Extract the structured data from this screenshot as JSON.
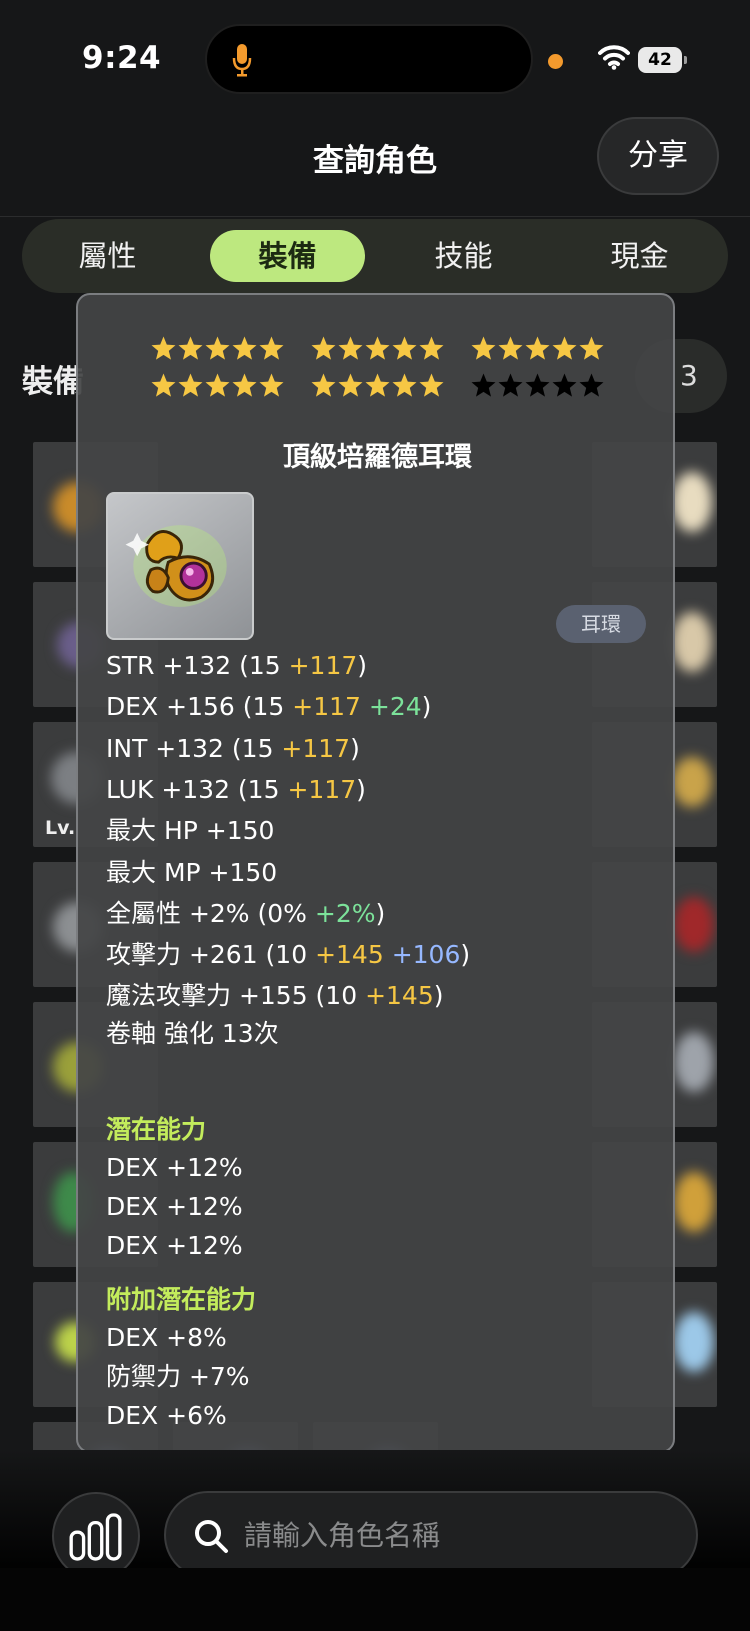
{
  "status_bar": {
    "time": "9:24",
    "battery": "42"
  },
  "header": {
    "title": "查詢角色",
    "share_label": "分享"
  },
  "tabs": [
    {
      "label": "屬性"
    },
    {
      "label": "裝備"
    },
    {
      "label": "技能"
    },
    {
      "label": "現金"
    }
  ],
  "background": {
    "section_heading": "裝備",
    "pill_text": "3",
    "slot_level_text": "Lv."
  },
  "item": {
    "stars_filled": 25,
    "stars_total": 30,
    "name": "頂級培羅德耳環",
    "type_badge": "耳環",
    "stats": [
      {
        "parts": [
          {
            "t": "STR +132 (15 ",
            "c": "w"
          },
          {
            "t": "+117",
            "c": "y"
          },
          {
            "t": ")",
            "c": "w"
          }
        ]
      },
      {
        "parts": [
          {
            "t": "DEX +156 (15 ",
            "c": "w"
          },
          {
            "t": "+117",
            "c": "y"
          },
          {
            "t": " ",
            "c": "w"
          },
          {
            "t": "+24",
            "c": "g"
          },
          {
            "t": ")",
            "c": "w"
          }
        ]
      },
      {
        "parts": [
          {
            "t": "INT +132 (15 ",
            "c": "w"
          },
          {
            "t": "+117",
            "c": "y"
          },
          {
            "t": ")",
            "c": "w"
          }
        ]
      },
      {
        "parts": [
          {
            "t": "LUK +132 (15 ",
            "c": "w"
          },
          {
            "t": "+117",
            "c": "y"
          },
          {
            "t": ")",
            "c": "w"
          }
        ]
      },
      {
        "parts": [
          {
            "t": "最大 HP +150",
            "c": "w"
          }
        ]
      },
      {
        "parts": [
          {
            "t": "最大 MP +150",
            "c": "w"
          }
        ]
      },
      {
        "parts": [
          {
            "t": "全屬性 +2% (0% ",
            "c": "w"
          },
          {
            "t": "+2%",
            "c": "g"
          },
          {
            "t": ")",
            "c": "w"
          }
        ]
      },
      {
        "parts": [
          {
            "t": "攻擊力 +261  (10 ",
            "c": "w"
          },
          {
            "t": "+145",
            "c": "y"
          },
          {
            "t": " ",
            "c": "w"
          },
          {
            "t": "+106",
            "c": "b"
          },
          {
            "t": ")",
            "c": "w"
          }
        ]
      },
      {
        "parts": [
          {
            "t": "魔法攻擊力 +155  (10 ",
            "c": "w"
          },
          {
            "t": "+145",
            "c": "y"
          },
          {
            "t": ")",
            "c": "w"
          }
        ]
      },
      {
        "parts": [
          {
            "t": "卷軸 強化 13次",
            "c": "w"
          }
        ]
      }
    ],
    "potential_title": "潛在能力",
    "potential": [
      "DEX +12%",
      "DEX +12%",
      "DEX +12%"
    ],
    "additional_title": "附加潛在能力",
    "additional": [
      "DEX +8%",
      "防禦力 +7%",
      "DEX +6%"
    ]
  },
  "search": {
    "placeholder": "請輸入角色名稱"
  },
  "colors": {
    "accent": "#bde87f",
    "star_filled": "#f6c744",
    "stat_yellow": "#f6c744",
    "stat_green": "#7ce29a",
    "stat_blue": "#96b8ff",
    "section_title": "#c3ec5c"
  }
}
